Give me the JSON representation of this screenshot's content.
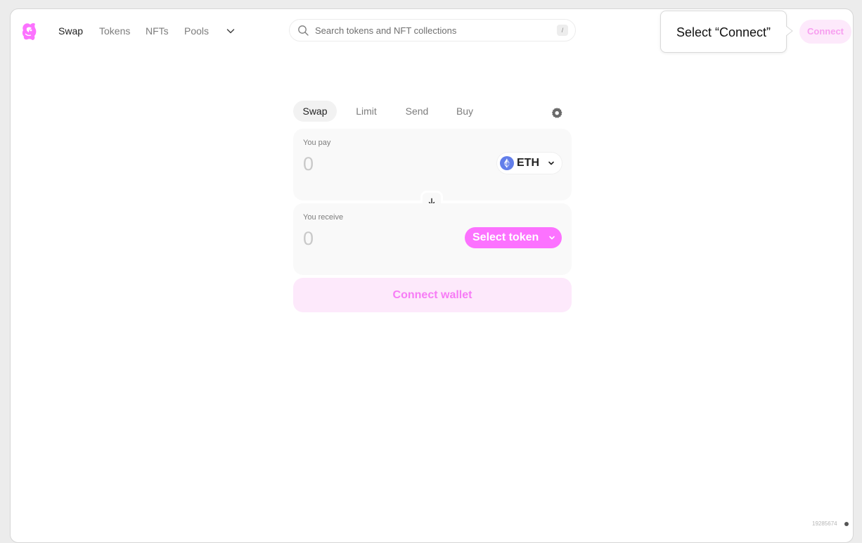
{
  "nav": {
    "links": {
      "swap": "Swap",
      "tokens": "Tokens",
      "nfts": "NFTs",
      "pools": "Pools"
    },
    "more_icon": "chevron-down-icon",
    "logo_icon": "unicorn-logo"
  },
  "search": {
    "placeholder": "Search tokens and NFT collections",
    "shortcut": "/",
    "icon": "search-icon"
  },
  "tooltip": {
    "text": "Select “Connect”"
  },
  "header": {
    "connect_label": "Connect"
  },
  "swap": {
    "tabs": {
      "swap": "Swap",
      "limit": "Limit",
      "send": "Send",
      "buy": "Buy"
    },
    "settings_icon": "gear-icon",
    "pay": {
      "label": "You pay",
      "amount_placeholder": "0",
      "token": "ETH",
      "token_icon": "eth-icon"
    },
    "switch_icon": "arrow-down-icon",
    "receive": {
      "label": "You receive",
      "amount_placeholder": "0",
      "select_label": "Select token"
    },
    "connect_wallet_label": "Connect wallet"
  },
  "footer": {
    "build_id": "19285674"
  },
  "colors": {
    "accent_pink": "#fc72ff",
    "soft_pink": "#fde9fb",
    "eth_blue": "#627eea",
    "text_dark": "#222222",
    "text_muted": "#7d7d7d"
  }
}
